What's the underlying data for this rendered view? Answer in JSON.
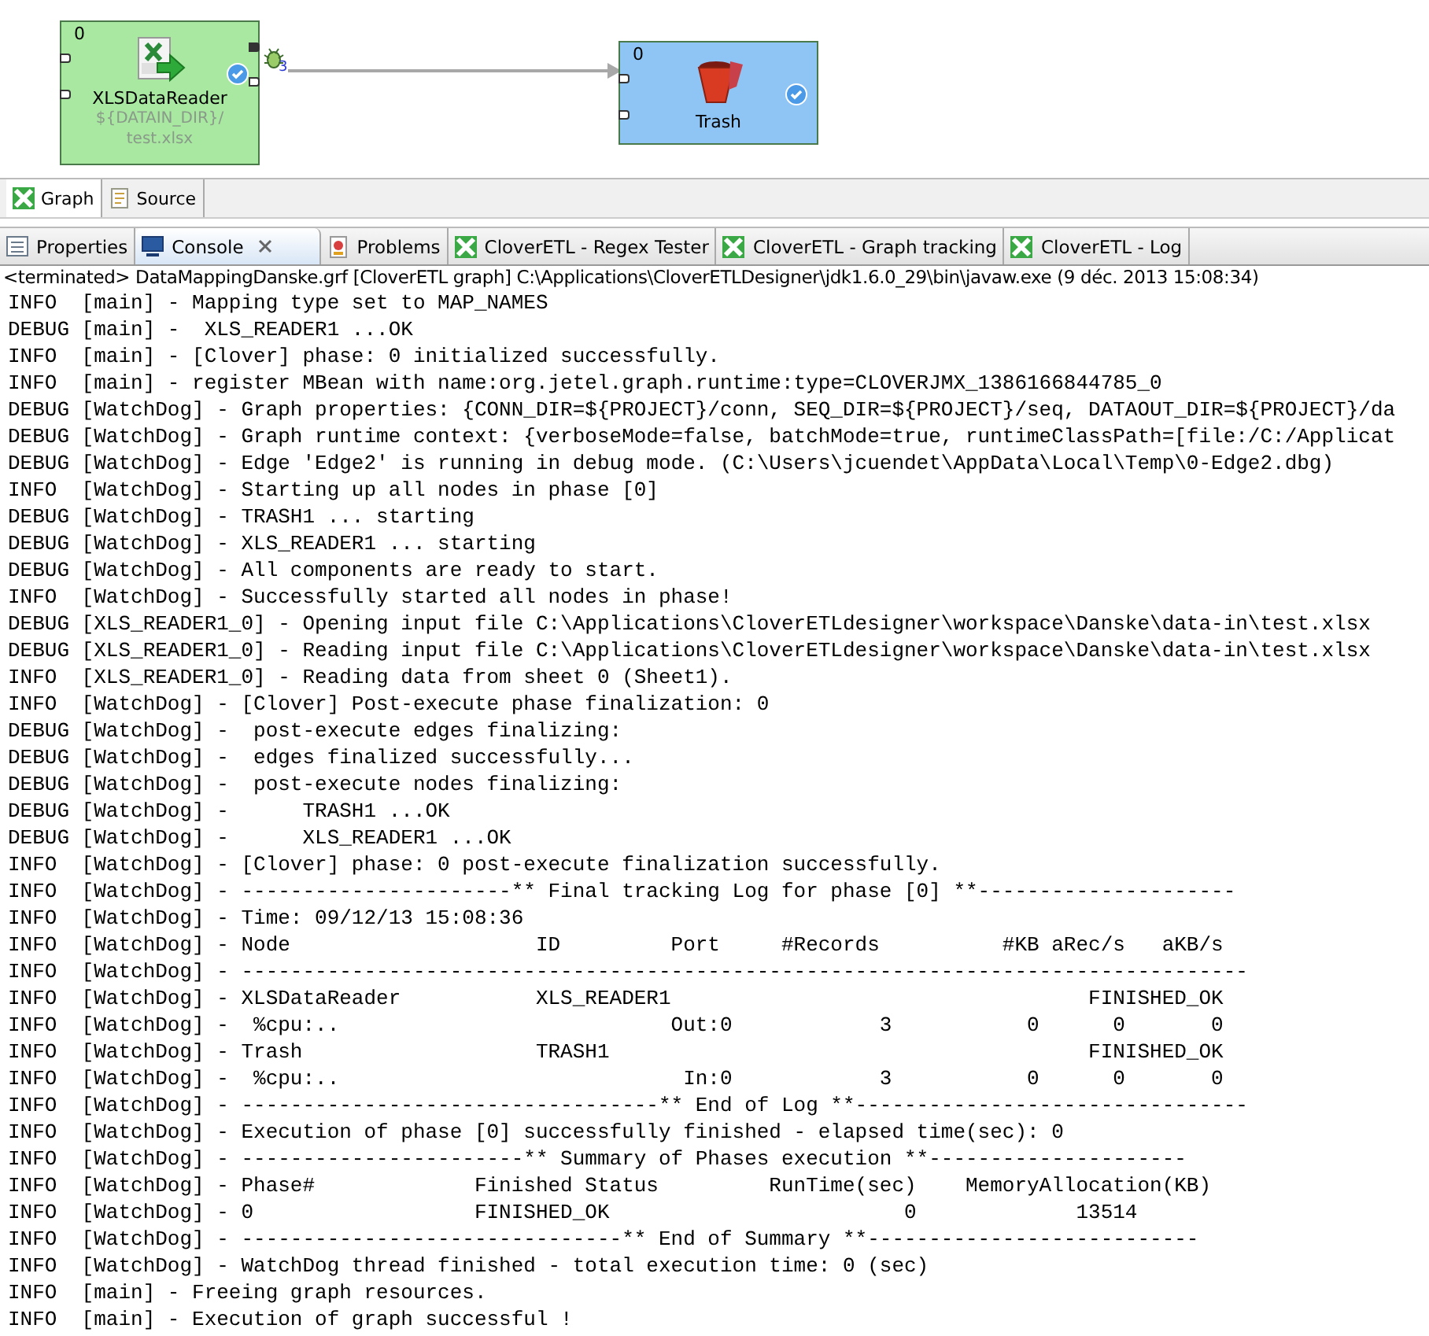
{
  "graph": {
    "nodes": [
      {
        "kind": "reader",
        "port_label": "0",
        "name": "XLSDataReader",
        "detail_lines": [
          "${DATAIN_DIR}/",
          "test.xlsx"
        ],
        "color": "#a8e8a0"
      },
      {
        "kind": "trash",
        "port_label": "0",
        "name": "Trash",
        "color": "#8ec5f5"
      }
    ],
    "edge": {
      "debug": true,
      "count": "3"
    }
  },
  "editor_tabs": [
    {
      "label": "Graph",
      "kind": "graph",
      "selected": true
    },
    {
      "label": "Source",
      "kind": "source",
      "selected": false
    }
  ],
  "console_tabs": [
    {
      "label": "Properties",
      "kind": "properties",
      "selected": false,
      "closable": false
    },
    {
      "label": "Console",
      "kind": "console",
      "selected": true,
      "closable": true
    },
    {
      "label": "Problems",
      "kind": "problems",
      "selected": false,
      "closable": false
    },
    {
      "label": "CloverETL - Regex Tester",
      "kind": "clover",
      "selected": false,
      "closable": false
    },
    {
      "label": "CloverETL - Graph tracking",
      "kind": "clover",
      "selected": false,
      "closable": false
    },
    {
      "label": "CloverETL - Log",
      "kind": "clover",
      "selected": false,
      "closable": false
    }
  ],
  "console": {
    "header": "<terminated> DataMappingDanske.grf [CloverETL graph] C:\\Applications\\CloverETLDesigner\\jdk1.6.0_29\\bin\\javaw.exe (9 déc. 2013 15:08:34)",
    "lines": [
      "INFO  [main] - Mapping type set to MAP_NAMES",
      "DEBUG [main] -  XLS_READER1 ...OK",
      "INFO  [main] - [Clover] phase: 0 initialized successfully.",
      "INFO  [main] - register MBean with name:org.jetel.graph.runtime:type=CLOVERJMX_1386166844785_0",
      "DEBUG [WatchDog] - Graph properties: {CONN_DIR=${PROJECT}/conn, SEQ_DIR=${PROJECT}/seq, DATAOUT_DIR=${PROJECT}/da",
      "DEBUG [WatchDog] - Graph runtime context: {verboseMode=false, batchMode=true, runtimeClassPath=[file:/C:/Applicat",
      "DEBUG [WatchDog] - Edge 'Edge2' is running in debug mode. (C:\\Users\\jcuendet\\AppData\\Local\\Temp\\0-Edge2.dbg)",
      "INFO  [WatchDog] - Starting up all nodes in phase [0]",
      "DEBUG [WatchDog] - TRASH1 ... starting",
      "DEBUG [WatchDog] - XLS_READER1 ... starting",
      "DEBUG [WatchDog] - All components are ready to start.",
      "INFO  [WatchDog] - Successfully started all nodes in phase!",
      "DEBUG [XLS_READER1_0] - Opening input file C:\\Applications\\CloverETLdesigner\\workspace\\Danske\\data-in\\test.xlsx",
      "DEBUG [XLS_READER1_0] - Reading input file C:\\Applications\\CloverETLdesigner\\workspace\\Danske\\data-in\\test.xlsx",
      "INFO  [XLS_READER1_0] - Reading data from sheet 0 (Sheet1).",
      "INFO  [WatchDog] - [Clover] Post-execute phase finalization: 0",
      "DEBUG [WatchDog] -  post-execute edges finalizing:",
      "DEBUG [WatchDog] -  edges finalized successfully...",
      "DEBUG [WatchDog] -  post-execute nodes finalizing:",
      "DEBUG [WatchDog] -      TRASH1 ...OK",
      "DEBUG [WatchDog] -      XLS_READER1 ...OK",
      "INFO  [WatchDog] - [Clover] phase: 0 post-execute finalization successfully.",
      "INFO  [WatchDog] - ----------------------** Final tracking Log for phase [0] **---------------------",
      "INFO  [WatchDog] - Time: 09/12/13 15:08:36",
      "INFO  [WatchDog] - Node                    ID         Port     #Records          #KB aRec/s   aKB/s",
      "INFO  [WatchDog] - ----------------------------------------------------------------------------------",
      "INFO  [WatchDog] - XLSDataReader           XLS_READER1                                  FINISHED_OK",
      "INFO  [WatchDog] -  %cpu:..                           Out:0            3           0      0       0",
      "INFO  [WatchDog] - Trash                   TRASH1                                       FINISHED_OK",
      "INFO  [WatchDog] -  %cpu:..                            In:0            3           0      0       0",
      "INFO  [WatchDog] - ----------------------------------** End of Log **--------------------------------",
      "INFO  [WatchDog] - Execution of phase [0] successfully finished - elapsed time(sec): 0",
      "INFO  [WatchDog] - -----------------------** Summary of Phases execution **---------------------",
      "INFO  [WatchDog] - Phase#             Finished Status         RunTime(sec)    MemoryAllocation(KB)",
      "INFO  [WatchDog] - 0                  FINISHED_OK                        0             13514",
      "INFO  [WatchDog] - -------------------------------** End of Summary **---------------------------",
      "INFO  [WatchDog] - WatchDog thread finished - total execution time: 0 (sec)",
      "INFO  [main] - Freeing graph resources.",
      "INFO  [main] - Execution of graph successful !"
    ]
  }
}
